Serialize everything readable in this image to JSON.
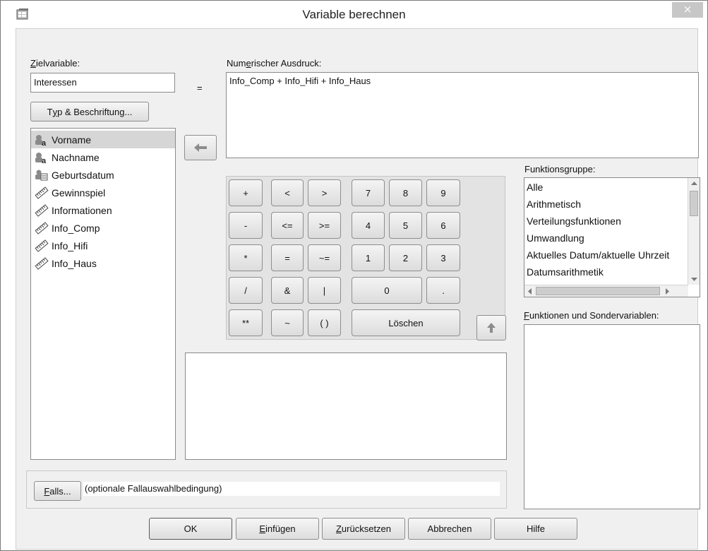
{
  "window": {
    "title": "Variable berechnen",
    "close": "×"
  },
  "target": {
    "label_pre": "",
    "label_u": "Z",
    "label_post": "ielvariable:",
    "value": "Interessen"
  },
  "equals": "=",
  "type_button": {
    "pre": "T",
    "u": "y",
    "post": "p & Beschriftung..."
  },
  "variables": [
    {
      "name": "Vorname",
      "icon": "string-variable-icon",
      "selected": true
    },
    {
      "name": "Nachname",
      "icon": "string-variable-icon"
    },
    {
      "name": "Geburtsdatum",
      "icon": "date-variable-icon"
    },
    {
      "name": "Gewinnspiel",
      "icon": "scale-variable-icon"
    },
    {
      "name": "Informationen",
      "icon": "scale-variable-icon"
    },
    {
      "name": "Info_Comp",
      "icon": "scale-variable-icon"
    },
    {
      "name": "Info_Hifi",
      "icon": "scale-variable-icon"
    },
    {
      "name": "Info_Haus",
      "icon": "scale-variable-icon"
    }
  ],
  "expression": {
    "label_pre": "Num",
    "label_u": "e",
    "label_post": "rischer Ausdruck:",
    "value": "Info_Comp + Info_Hifi + Info_Haus"
  },
  "keypad": {
    "row1": [
      "+",
      "<",
      ">",
      "7",
      "8",
      "9"
    ],
    "row2": [
      "-",
      "<=",
      ">=",
      "4",
      "5",
      "6"
    ],
    "row3": [
      "*",
      "=",
      "~=",
      "1",
      "2",
      "3"
    ],
    "row4": [
      "/",
      "&",
      "|",
      "0",
      "."
    ],
    "row5": [
      "**",
      "~",
      "( )",
      "Löschen"
    ]
  },
  "function_group": {
    "label_pre": "Funktions",
    "label_u": "g",
    "label_post": "ruppe:",
    "items": [
      "Alle",
      "Arithmetisch",
      "Verteilungsfunktionen",
      "Umwandlung",
      "Aktuelles Datum/aktuelle Uhrzeit",
      "Datumsarithmetik"
    ]
  },
  "functions_label": {
    "u": "F",
    "post": "unktionen und Sondervariablen:"
  },
  "if_button": {
    "u": "F",
    "post": "alls..."
  },
  "if_text": "(optionale Fallauswahlbedingung)",
  "buttons": {
    "ok": "OK",
    "paste": {
      "u": "E",
      "post": "infügen"
    },
    "reset": {
      "u": "Z",
      "post": "urücksetzen"
    },
    "cancel": "Abbrechen",
    "help": "Hilfe"
  }
}
